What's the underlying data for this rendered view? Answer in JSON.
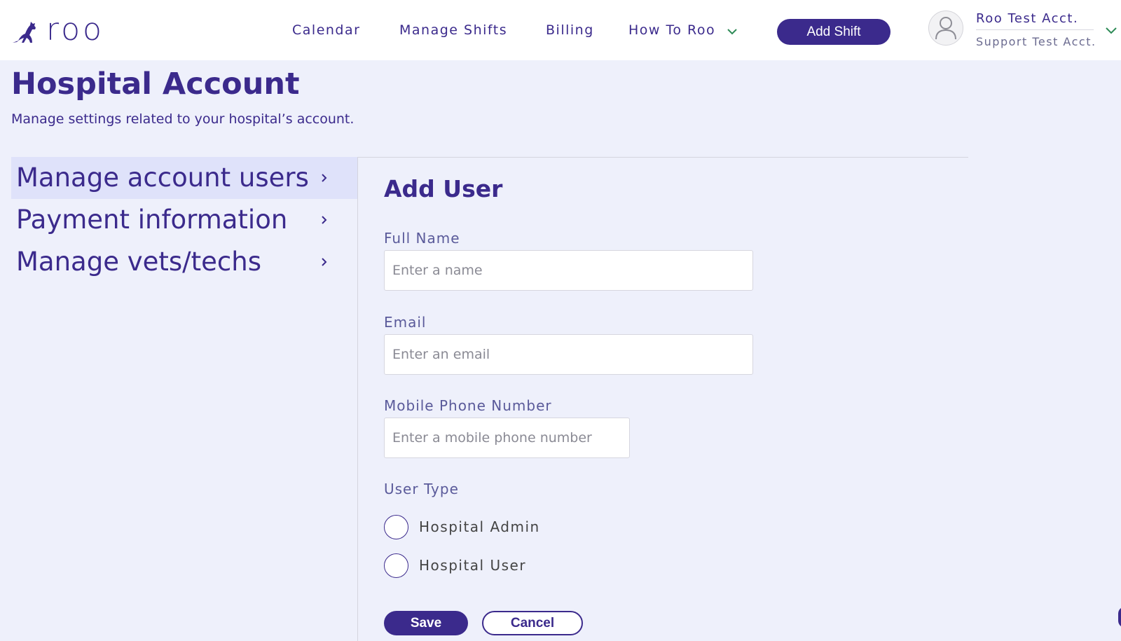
{
  "header": {
    "logo_text": "roo",
    "nav": {
      "calendar": "Calendar",
      "manage_shifts": "Manage Shifts",
      "billing": "Billing",
      "how_to_roo": "How To Roo"
    },
    "add_shift_label": "Add Shift",
    "account_name": "Roo Test Acct.",
    "account_sub": "Support Test Acct."
  },
  "page": {
    "title": "Hospital Account",
    "subtitle": "Manage settings related to your hospital’s account."
  },
  "sidebar": {
    "items": [
      {
        "label": "Manage account users",
        "active": true
      },
      {
        "label": "Payment information",
        "active": false
      },
      {
        "label": "Manage vets/techs",
        "active": false
      }
    ]
  },
  "form": {
    "title": "Add User",
    "full_name": {
      "label": "Full Name",
      "placeholder": "Enter a name",
      "value": ""
    },
    "email": {
      "label": "Email",
      "placeholder": "Enter an email",
      "value": ""
    },
    "phone": {
      "label": "Mobile Phone Number",
      "placeholder": "Enter a mobile phone number",
      "value": ""
    },
    "user_type": {
      "label": "User Type",
      "options": [
        "Hospital Admin",
        "Hospital User"
      ],
      "selected": null
    },
    "save_label": "Save",
    "cancel_label": "Cancel"
  },
  "colors": {
    "brand": "#3b2a8c",
    "background": "#eef0fb",
    "active_menu": "#dfe2fa",
    "nav_chevron": "#2e8b57"
  },
  "icons": {
    "logo": "kangaroo-icon",
    "nav_dropdown": "chevron-down-icon",
    "avatar": "user-avatar-icon",
    "menu_arrow": "chevron-right-icon"
  }
}
